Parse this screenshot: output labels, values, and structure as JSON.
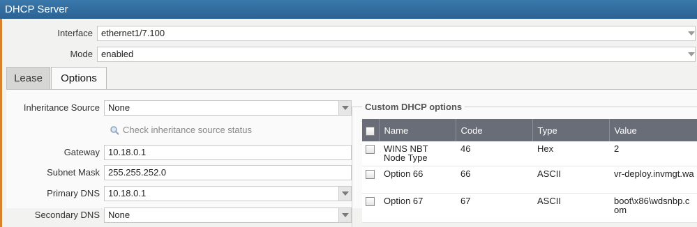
{
  "window": {
    "title": "DHCP Server"
  },
  "interface": {
    "label": "Interface",
    "value": "ethernet1/7.100"
  },
  "mode": {
    "label": "Mode",
    "value": "enabled"
  },
  "tabs": [
    {
      "label": "Lease"
    },
    {
      "label": "Options"
    }
  ],
  "options": {
    "inheritance_source": {
      "label": "Inheritance Source",
      "value": "None"
    },
    "check_link": "Check inheritance source status",
    "gateway": {
      "label": "Gateway",
      "value": "10.18.0.1"
    },
    "subnet_mask": {
      "label": "Subnet Mask",
      "value": "255.255.252.0"
    },
    "primary_dns": {
      "label": "Primary DNS",
      "value": "10.18.0.1"
    },
    "secondary_dns": {
      "label": "Secondary DNS",
      "value": "None"
    }
  },
  "custom": {
    "legend": "Custom DHCP options",
    "columns": [
      "Name",
      "Code",
      "Type",
      "Value"
    ],
    "rows": [
      {
        "name": "WINS NBT Node Type",
        "code": "46",
        "type": "Hex",
        "value": "2"
      },
      {
        "name": "Option 66",
        "code": "66",
        "type": "ASCII",
        "value": "vr-deploy.invmgt.wa"
      },
      {
        "name": "Option 67",
        "code": "67",
        "type": "ASCII",
        "value": "boot\\x86\\wdsnbp.com"
      }
    ]
  },
  "colors": {
    "title_bar": "#2c6294",
    "accent_border": "#d9822b",
    "grid_header": "#686d78"
  }
}
